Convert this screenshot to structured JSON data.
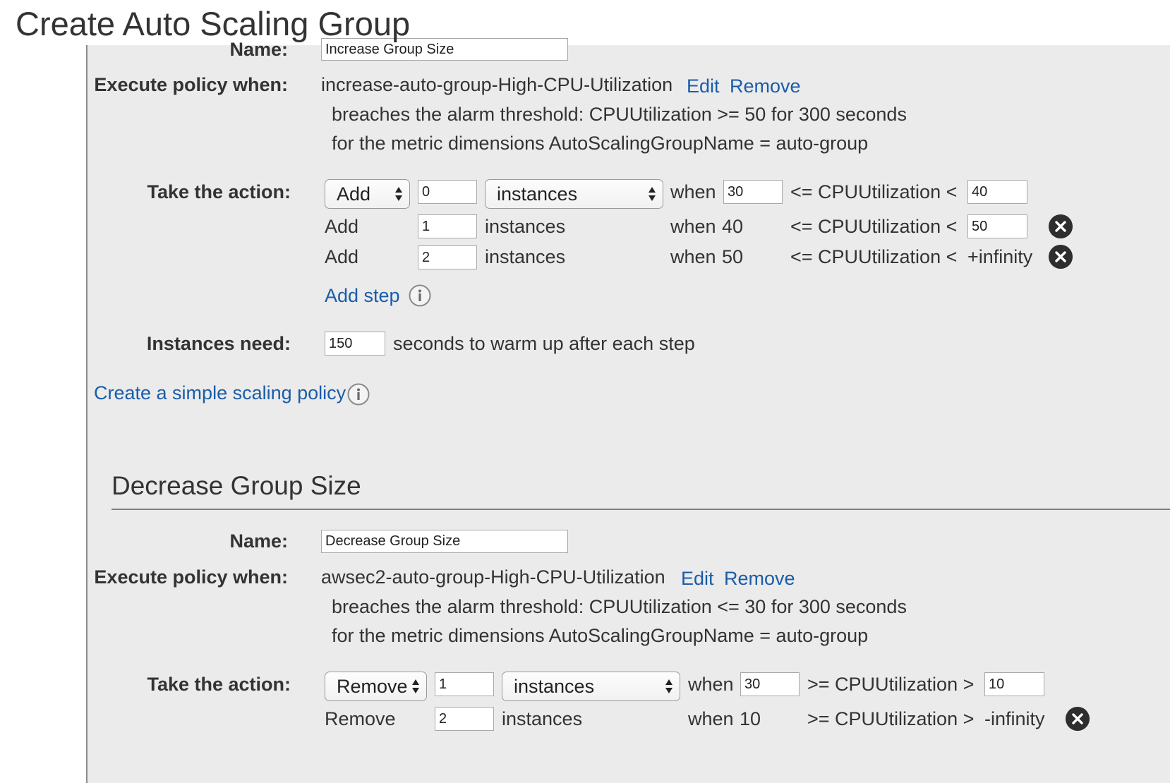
{
  "page_title": "Create Auto Scaling Group",
  "increase": {
    "name_label": "Name:",
    "name_value": "Increase Group Size",
    "execute_label": "Execute policy when:",
    "alarm_name": "increase-auto-group-High-CPU-Utilization",
    "edit_label": "Edit",
    "remove_label": "Remove",
    "alarm_threshold_text": "breaches the alarm threshold: CPUUtilization >= 50 for 300 seconds",
    "alarm_dimensions_text": "for the metric dimensions AutoScalingGroupName = auto-group",
    "action_label": "Take the action:",
    "steps": [
      {
        "action": "Add",
        "amount": "0",
        "unit": "instances",
        "when": "when",
        "lower": "30",
        "metric": "<= CPUUtilization <",
        "upper": "40"
      },
      {
        "action": "Add",
        "amount": "1",
        "unit": "instances",
        "when": "when",
        "lower": "40",
        "metric": "<= CPUUtilization <",
        "upper": "50"
      },
      {
        "action": "Add",
        "amount": "2",
        "unit": "instances",
        "when": "when",
        "lower": "50",
        "metric": "<= CPUUtilization <",
        "upper": "+infinity"
      }
    ],
    "add_step_label": "Add step",
    "instances_need_label": "Instances need:",
    "warmup_value": "150",
    "warmup_text": "seconds to warm up after each step",
    "create_simple_label": "Create a simple scaling policy"
  },
  "decrease": {
    "section_title": "Decrease Group Size",
    "name_label": "Name:",
    "name_value": "Decrease Group Size",
    "execute_label": "Execute policy when:",
    "alarm_name": "awsec2-auto-group-High-CPU-Utilization",
    "edit_label": "Edit",
    "remove_label": "Remove",
    "alarm_threshold_text": "breaches the alarm threshold: CPUUtilization <= 30 for 300 seconds",
    "alarm_dimensions_text": "for the metric dimensions AutoScalingGroupName = auto-group",
    "action_label": "Take the action:",
    "steps": [
      {
        "action": "Remove",
        "amount": "1",
        "unit": "instances",
        "when": "when",
        "lower": "30",
        "metric": ">= CPUUtilization >",
        "upper": "10"
      },
      {
        "action": "Remove",
        "amount": "2",
        "unit": "instances",
        "when": "when",
        "lower": "10",
        "metric": ">= CPUUtilization >",
        "upper": "-infinity"
      }
    ]
  },
  "icons": {
    "info": "info-icon",
    "close": "close-icon",
    "select_arrows": "select-arrows-icon"
  },
  "colors": {
    "link": "#1a5ca8",
    "panel_bg": "#ebebeb",
    "text": "#333333"
  }
}
